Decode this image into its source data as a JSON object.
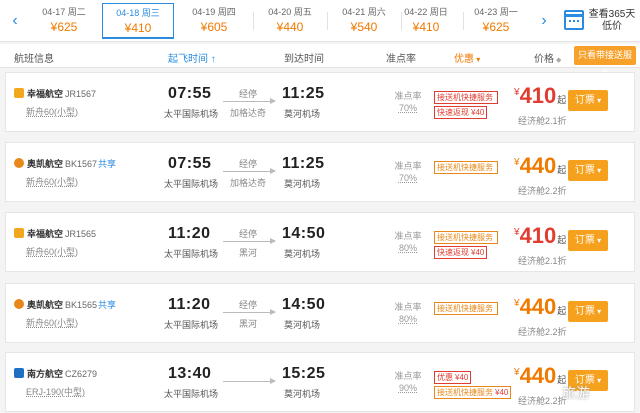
{
  "date_strip": {
    "days": [
      {
        "date": "04-17 周二",
        "price": "¥625",
        "active": false
      },
      {
        "date": "04-18 周三",
        "price": "¥410",
        "active": true
      },
      {
        "date": "04-19 周四",
        "price": "¥605",
        "active": false
      },
      {
        "date": "04-20 周五",
        "price": "¥440",
        "active": false
      },
      {
        "date": "04-21 周六",
        "price": "¥540",
        "active": false
      },
      {
        "date": "04-22 周日",
        "price": "¥410",
        "active": false
      },
      {
        "date": "04-23 周一",
        "price": "¥625",
        "active": false
      }
    ],
    "calendar_label": "查看365天低价",
    "prev_icon": "‹",
    "next_icon": "›"
  },
  "columns": {
    "airline": "航班信息",
    "depart": "起飞时间",
    "arrive": "到达时间",
    "ontime": "准点率",
    "offer": "优惠",
    "price": "价格",
    "pickup_button": "只看带接送服务"
  },
  "flights": [
    {
      "airline": "幸福航空",
      "code": "JR1567",
      "share": "",
      "plane": "新舟60(小型)",
      "depart_time": "07:55",
      "depart_airport": "太平国际机场",
      "arrive_time": "11:25",
      "arrive_airport": "莫河机场",
      "via_label": "经停",
      "via_city": "加格达奇",
      "ontime_label": "准点率",
      "ontime_value": "70%",
      "tag1": "接送机快捷服务",
      "tag1_val": "",
      "tag1_color": "red",
      "tag2": "快速返现",
      "tag2_val": "¥40",
      "tag2_color": "red",
      "price_currency": "¥",
      "price": "410",
      "price_suffix": "起",
      "price_color": "red",
      "discount": "经济舱2.1折",
      "book": "订票",
      "logo_color": "#f2a81d"
    },
    {
      "airline": "奥凯航空",
      "code": "BK1567",
      "share": "共享",
      "plane": "新舟60(小型)",
      "depart_time": "07:55",
      "depart_airport": "太平国际机场",
      "arrive_time": "11:25",
      "arrive_airport": "莫河机场",
      "via_label": "经停",
      "via_city": "加格达奇",
      "ontime_label": "准点率",
      "ontime_value": "70%",
      "tag1": "接送机快捷服务",
      "tag1_val": "",
      "tag1_color": "orange",
      "tag2": "",
      "tag2_val": "",
      "tag2_color": "",
      "price_currency": "¥",
      "price": "440",
      "price_suffix": "起",
      "price_color": "orange",
      "discount": "经济舱2.2折",
      "book": "订票",
      "logo_color": "#e8881a"
    },
    {
      "airline": "幸福航空",
      "code": "JR1565",
      "share": "",
      "plane": "新舟60(小型)",
      "depart_time": "11:20",
      "depart_airport": "太平国际机场",
      "arrive_time": "14:50",
      "arrive_airport": "莫河机场",
      "via_label": "经停",
      "via_city": "黑河",
      "ontime_label": "准点率",
      "ontime_value": "80%",
      "tag1": "接送机快捷服务",
      "tag1_val": "",
      "tag1_color": "orange",
      "tag2": "快速返现",
      "tag2_val": "¥40",
      "tag2_color": "red",
      "price_currency": "¥",
      "price": "410",
      "price_suffix": "起",
      "price_color": "red",
      "discount": "经济舱2.1折",
      "book": "订票",
      "logo_color": "#f2a81d"
    },
    {
      "airline": "奥凯航空",
      "code": "BK1565",
      "share": "共享",
      "plane": "新舟60(小型)",
      "depart_time": "11:20",
      "depart_airport": "太平国际机场",
      "arrive_time": "14:50",
      "arrive_airport": "莫河机场",
      "via_label": "经停",
      "via_city": "黑河",
      "ontime_label": "准点率",
      "ontime_value": "80%",
      "tag1": "接送机快捷服务",
      "tag1_val": "",
      "tag1_color": "orange",
      "tag2": "",
      "tag2_val": "",
      "tag2_color": "",
      "price_currency": "¥",
      "price": "440",
      "price_suffix": "起",
      "price_color": "orange",
      "discount": "经济舱2.2折",
      "book": "订票",
      "logo_color": "#e8881a"
    },
    {
      "airline": "南方航空",
      "code": "CZ6279",
      "share": "",
      "plane": "ERJ-190(中型)",
      "depart_time": "13:40",
      "depart_airport": "太平国际机场",
      "arrive_time": "15:25",
      "arrive_airport": "莫河机场",
      "via_label": "",
      "via_city": "",
      "ontime_label": "准点率",
      "ontime_value": "90%",
      "tag1": "优惠",
      "tag1_val": "¥40",
      "tag1_color": "red",
      "tag2": "接送机快捷服务",
      "tag2_val": "¥40",
      "tag2_color": "orange",
      "price_currency": "¥",
      "price": "440",
      "price_suffix": "起",
      "price_color": "orange",
      "discount": "经济舱2.2折",
      "book": "订票",
      "logo_color": "#1f6fc2"
    }
  ],
  "watermark": "旅游"
}
